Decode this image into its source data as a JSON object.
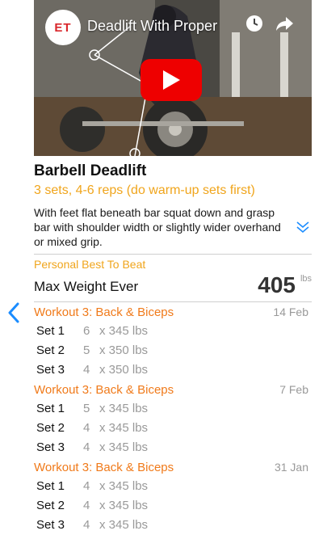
{
  "video": {
    "title": "Deadlift With Proper",
    "channel_logo_text": "ET"
  },
  "exercise": {
    "name": "Barbell Deadlift",
    "prescription": "3 sets, 4-6 reps (do warm-up sets first)",
    "description": "With feet flat beneath bar squat down and grasp bar with shoulder width or slightly wider overhand or mixed grip."
  },
  "personal_best": {
    "label": "Personal Best To Beat",
    "metric": "Max Weight Ever",
    "value": "405",
    "unit": "lbs"
  },
  "workouts": [
    {
      "name": "Workout 3: Back & Biceps",
      "date": "14 Feb",
      "sets": [
        {
          "label": "Set 1",
          "reps": "6",
          "weight": "x 345 lbs"
        },
        {
          "label": "Set 2",
          "reps": "5",
          "weight": "x 350 lbs"
        },
        {
          "label": "Set 3",
          "reps": "4",
          "weight": "x 350 lbs"
        }
      ]
    },
    {
      "name": "Workout 3: Back & Biceps",
      "date": "7 Feb",
      "sets": [
        {
          "label": "Set 1",
          "reps": "5",
          "weight": "x 345 lbs"
        },
        {
          "label": "Set 2",
          "reps": "4",
          "weight": "x 345 lbs"
        },
        {
          "label": "Set 3",
          "reps": "4",
          "weight": "x 345 lbs"
        }
      ]
    },
    {
      "name": "Workout 3: Back & Biceps",
      "date": "31 Jan",
      "sets": [
        {
          "label": "Set 1",
          "reps": "4",
          "weight": "x 345 lbs"
        },
        {
          "label": "Set 2",
          "reps": "4",
          "weight": "x 345 lbs"
        },
        {
          "label": "Set 3",
          "reps": "4",
          "weight": "x 345 lbs"
        }
      ]
    }
  ],
  "colors": {
    "accent_yellow": "#f0a51c",
    "accent_orange": "#f07a1a",
    "link_blue": "#1a8cff",
    "play_red": "#ee0000"
  },
  "icons": [
    "back-chevron-icon",
    "clock-icon",
    "share-icon",
    "play-icon",
    "expand-chevron-icon"
  ]
}
